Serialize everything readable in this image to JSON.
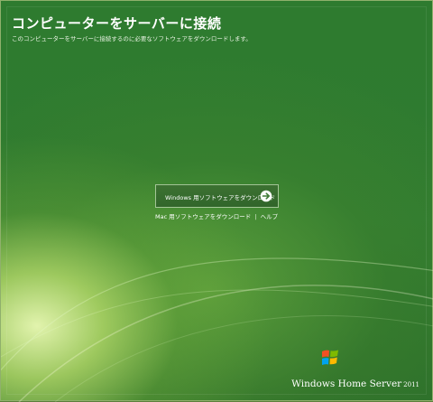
{
  "page": {
    "title": "コンピューターをサーバーに接続",
    "subtitle": "このコンピューターをサーバーに接続するのに必要なソフトウェアをダウンロードします。"
  },
  "download": {
    "windows_label": "Windows 用ソフトウェアをダウンロード",
    "arrow_icon": "arrow-right-circle-icon"
  },
  "links": {
    "mac_label": "Mac 用ソフトウェアをダウンロード",
    "separator": "|",
    "help_label": "ヘルプ"
  },
  "brand": {
    "name": "Windows Home Server",
    "year": "2011",
    "logo_icon": "windows-flag-icon"
  },
  "colors": {
    "background": "#2e7b2f",
    "highlight": "#ebfab4",
    "text": "#ffffff"
  }
}
